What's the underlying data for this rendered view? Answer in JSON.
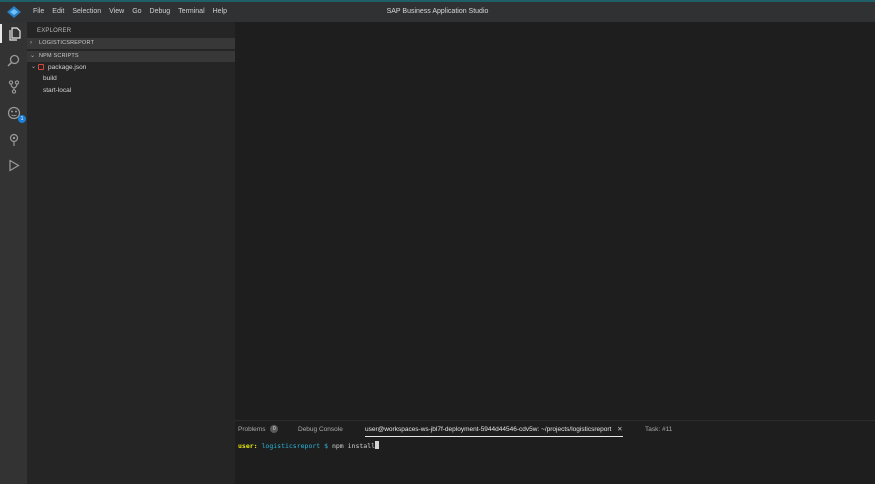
{
  "titlebar": {
    "menu": [
      "File",
      "Edit",
      "Selection",
      "View",
      "Go",
      "Debug",
      "Terminal",
      "Help"
    ],
    "title": "SAP Business Application Studio"
  },
  "activity_bar": {
    "items": [
      {
        "icon": "files-icon",
        "active": true
      },
      {
        "icon": "search-icon"
      },
      {
        "icon": "source-control-icon"
      },
      {
        "icon": "extensions-icon",
        "badge": "1"
      },
      {
        "icon": "remote-icon"
      },
      {
        "icon": "run-debug-icon"
      }
    ]
  },
  "sidebar": {
    "title": "EXPLORER",
    "sections": [
      {
        "label": "LOGISTICSREPORT",
        "expanded": false
      },
      {
        "label": "NPM SCRIPTS",
        "expanded": true
      }
    ],
    "package_file": "package.json",
    "scripts": [
      "build",
      "start-local"
    ]
  },
  "panel": {
    "tabs": [
      {
        "label": "Problems",
        "count": "0"
      },
      {
        "label": "Debug Console"
      },
      {
        "label": "user@workspaces-ws-jbl7f-deployment-5944d44546-cdv5w: ~/projects/logisticsreport",
        "active": true,
        "closable": true
      },
      {
        "label": "Task: #11"
      }
    ],
    "terminal": {
      "user": "user:",
      "project": "logisticsreport",
      "prompt": "$",
      "command": "npm install"
    }
  },
  "colors": {
    "accent": "#1d7fd6",
    "terminal_user": "#e5e510",
    "terminal_project": "#29b8db"
  }
}
